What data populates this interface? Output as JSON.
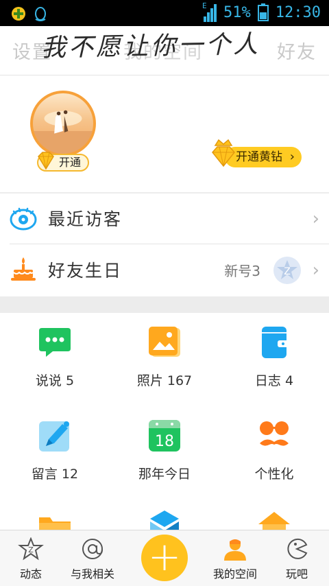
{
  "statusbar": {
    "network_label": "E",
    "battery": "51%",
    "time": "12:30"
  },
  "header": {
    "settings_label": "设置",
    "title": "我的空间",
    "friends_label": "好友",
    "signature": "我不愿让你一个人"
  },
  "profile": {
    "vip_label": "开通",
    "yellow_diamond_label": "开通黄钻"
  },
  "list": {
    "visitors_label": "最近访客",
    "birthdays_label": "好友生日",
    "birthdays_extra": "新号3"
  },
  "grid": {
    "items": [
      {
        "label": "说说 5",
        "icon": "chat-bubble-icon"
      },
      {
        "label": "照片 167",
        "icon": "photo-icon"
      },
      {
        "label": "日志 4",
        "icon": "journal-icon"
      },
      {
        "label": "留言 12",
        "icon": "message-pen-icon"
      },
      {
        "label": "那年今日",
        "icon": "calendar-icon"
      },
      {
        "label": "个性化",
        "icon": "mustache-glasses-icon"
      }
    ],
    "calendar_day": "18"
  },
  "bottomnav": {
    "items": [
      {
        "label": "动态"
      },
      {
        "label": "与我相关"
      },
      {
        "label": "我的空间"
      },
      {
        "label": "玩吧"
      }
    ],
    "plus_label": "+"
  },
  "colors": {
    "accent_yellow": "#ffc21e",
    "accent_blue": "#1ea7f0",
    "green": "#1fc35f",
    "orange": "#ff8a1c"
  }
}
